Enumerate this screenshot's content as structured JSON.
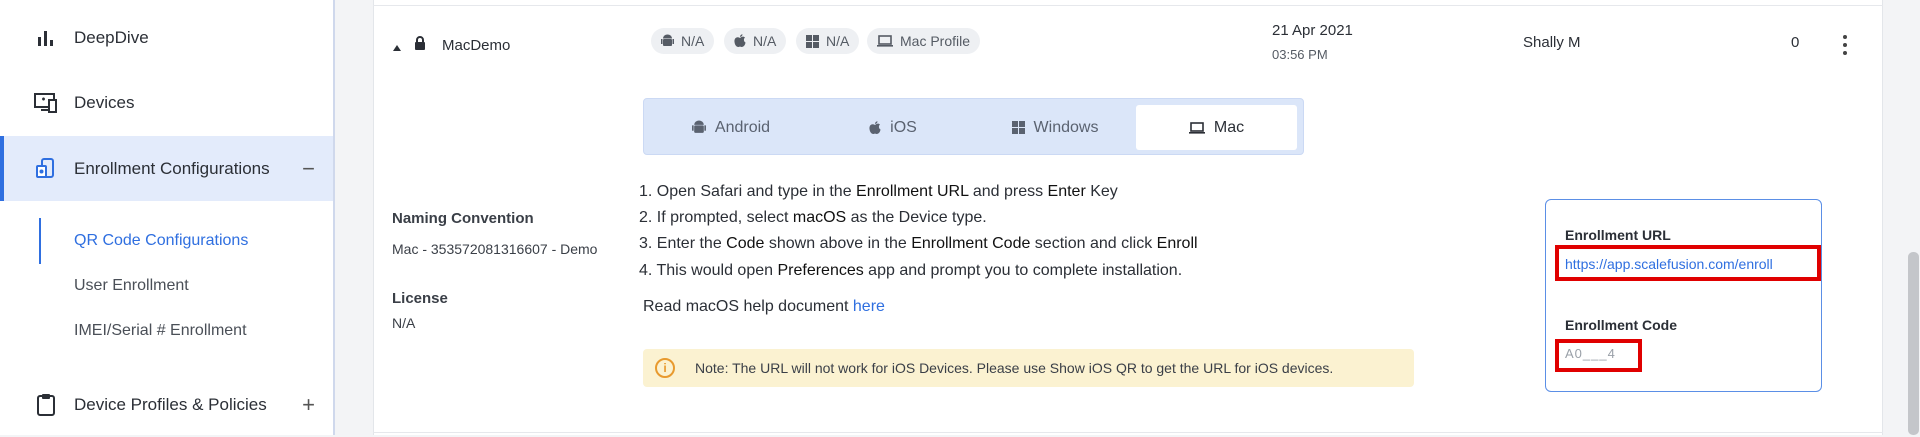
{
  "sidebar": {
    "items": [
      {
        "label": "DeepDive",
        "icon": "bar-chart-icon"
      },
      {
        "label": "Devices",
        "icon": "devices-icon"
      },
      {
        "label": "Enrollment Configurations",
        "icon": "enrollment-icon",
        "toggle": "−"
      },
      {
        "label": "Device Profiles & Policies",
        "icon": "clipboard-icon",
        "toggle": "+"
      }
    ],
    "sub_items": [
      "QR Code Configurations",
      "User Enrollment",
      "IMEI/Serial # Enrollment"
    ]
  },
  "row": {
    "name": "MacDemo",
    "platforms": [
      {
        "icon": "android-icon",
        "label": "N/A"
      },
      {
        "icon": "apple-icon",
        "label": "N/A"
      },
      {
        "icon": "windows-icon",
        "label": "N/A"
      },
      {
        "icon": "laptop-icon",
        "label": "Mac Profile"
      }
    ],
    "date": "21 Apr 2021",
    "time": "03:56 PM",
    "owner": "Shally M",
    "count": "0"
  },
  "details": {
    "naming_label": "Naming Convention",
    "naming_value": "Mac - 353572081316607 - Demo",
    "license_label": "License",
    "license_value": "N/A"
  },
  "tabs": [
    {
      "label": "Android",
      "icon": "android-icon"
    },
    {
      "label": "iOS",
      "icon": "apple-icon"
    },
    {
      "label": "Windows",
      "icon": "windows-icon"
    },
    {
      "label": "Mac",
      "icon": "laptop-icon",
      "active": true
    }
  ],
  "steps": {
    "s1": [
      "1. Open Safari and type in the ",
      "Enrollment URL",
      " and press ",
      "Enter",
      " Key"
    ],
    "s2": [
      "2. If prompted, select ",
      "macOS",
      " as the Device type."
    ],
    "s3": [
      "3. Enter the ",
      "Code",
      " shown above in the ",
      "Enrollment Code",
      " section and click ",
      "Enroll"
    ],
    "s4": [
      "4. This would open ",
      "Preferences",
      " app and prompt you to complete installation."
    ]
  },
  "help": {
    "text": "Read macOS help document ",
    "link": "here"
  },
  "note": "Note: The URL will not work for iOS Devices. Please use Show iOS QR to get the URL for iOS devices.",
  "enrollment": {
    "url_label": "Enrollment URL",
    "url": "https://app.scalefusion.com/enroll",
    "code_label": "Enrollment Code",
    "code": "A0___4"
  },
  "colors": {
    "accent": "#2f6fe0",
    "highlight": "#e00000",
    "note_bg": "#fbf2d1"
  }
}
